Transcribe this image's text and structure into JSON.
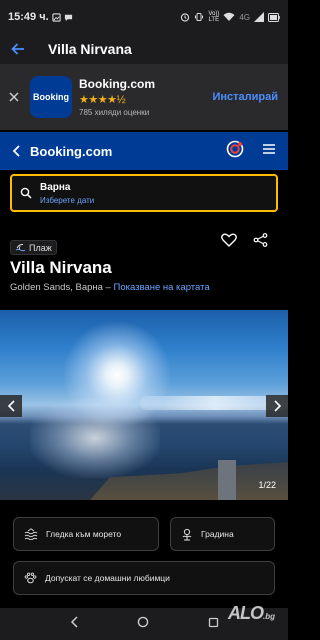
{
  "status_bar": {
    "time": "15:49 ч.",
    "network": "4G",
    "lte": "Vo))\nLTE"
  },
  "app_bar": {
    "title": "Villa Nirvana"
  },
  "promo": {
    "app_name": "Booking.com",
    "logo_text": "Booking",
    "stars_glyphs": "★★★★½",
    "rating": 4.5,
    "reviews": "785 хиляди оценки",
    "install_label": "Инсталирай"
  },
  "booking_header": {
    "brand": "Booking.com"
  },
  "search": {
    "destination": "Варна",
    "dates_placeholder": "Изберете дати"
  },
  "hotel": {
    "badge": "Плаж",
    "name": "Villa Nirvana",
    "location": "Golden Sands, Варна",
    "separator": " – ",
    "map_link": "Показване на картата"
  },
  "gallery": {
    "counter": "1/22"
  },
  "amenities": [
    {
      "label": "Гледка към морето",
      "icon": "sea-view-icon"
    },
    {
      "label": "Градина",
      "icon": "garden-icon"
    },
    {
      "label": "Допускат се домашни любимци",
      "icon": "pet-paw-icon"
    }
  ],
  "watermark": {
    "brand": "ALO",
    "suffix": ".bg"
  },
  "colors": {
    "booking_blue": "#003b95",
    "accent_yellow": "#febb02",
    "link_blue": "#6aa5ff",
    "star_gold": "#f2b01e"
  }
}
